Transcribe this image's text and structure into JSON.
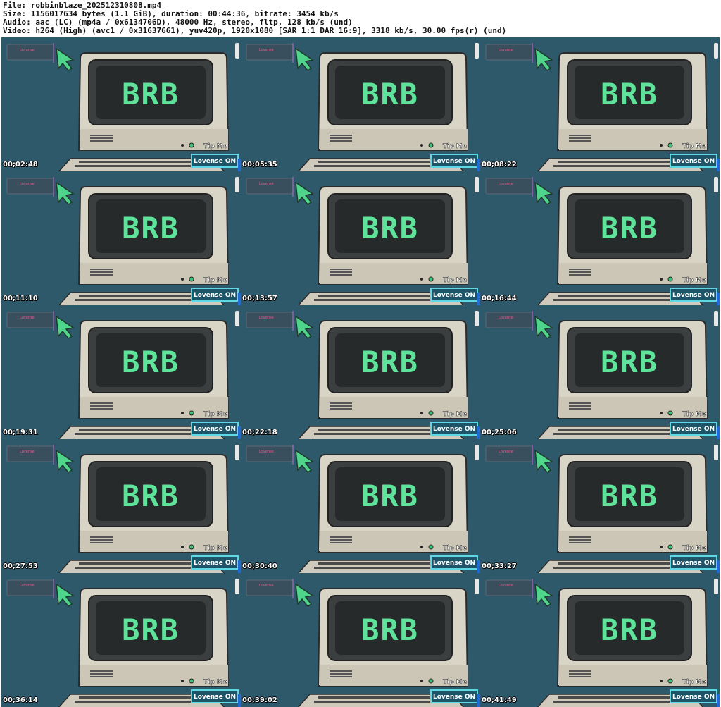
{
  "header": {
    "file_line": "File: robbinblaze_202512310808.mp4",
    "size_line": "Size: 1156017634 bytes (1.1 GiB), duration: 00:44:36, bitrate: 3454 kb/s",
    "audio_line": "Audio: aac (LC) (mp4a / 0x6134706D), 48000 Hz, stereo, fltp, 128 kb/s (und)",
    "video_line": "Video: h264 (High) (avc1 / 0x31637661), yuv420p, 1920x1080 [SAR 1:1 DAR 16:9], 3318 kb/s, 30.00 fps(r) (und)"
  },
  "scene": {
    "screen_text": "BRB",
    "tip_label": "Tip Me",
    "lovense_label": "Lovense ON",
    "lovense_small": "Lovense",
    "colors": {
      "background": "#2e596b",
      "screen_text": "#5fe39b",
      "cursor": "#4fd48c",
      "lovense_border": "#5fd8e6",
      "monitor": "#d8d4c6"
    }
  },
  "thumbnails": [
    {
      "timestamp": "00;02:48"
    },
    {
      "timestamp": "00;05:35"
    },
    {
      "timestamp": "00;08:22"
    },
    {
      "timestamp": "00;11:10"
    },
    {
      "timestamp": "00;13:57"
    },
    {
      "timestamp": "00;16:44"
    },
    {
      "timestamp": "00;19:31"
    },
    {
      "timestamp": "00;22:18"
    },
    {
      "timestamp": "00;25:06"
    },
    {
      "timestamp": "00;27:53"
    },
    {
      "timestamp": "00;30:40"
    },
    {
      "timestamp": "00;33:27"
    },
    {
      "timestamp": "00;36:14"
    },
    {
      "timestamp": "00;39:02"
    },
    {
      "timestamp": "00;41:49"
    }
  ]
}
